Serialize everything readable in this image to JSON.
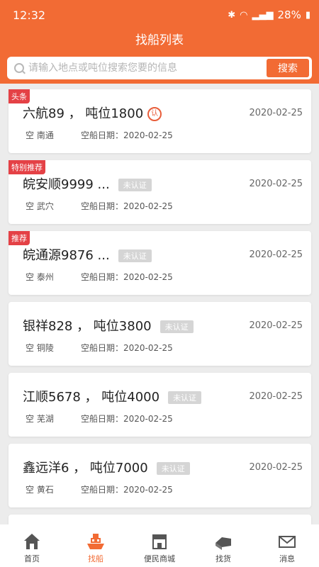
{
  "status_bar": {
    "time": "12:32",
    "battery": "28%"
  },
  "header": {
    "title": "找船列表"
  },
  "search": {
    "placeholder": "请输入地点或吨位搜索您要的信息",
    "button_label": "搜索"
  },
  "list": [
    {
      "tag": "头条",
      "name": "六航89 ， 吨位1800",
      "badge": "",
      "cert": "认",
      "date": "2020-02-25",
      "empty": "空 南通",
      "empty_date": "空船日期：2020-02-25"
    },
    {
      "tag": "特别推荐",
      "name": "皖安顺9999 ...",
      "badge": "未认证",
      "cert": "",
      "date": "2020-02-25",
      "empty": "空 武穴",
      "empty_date": "空船日期：2020-02-25"
    },
    {
      "tag": "推荐",
      "name": "皖通源9876 ...",
      "badge": "未认证",
      "cert": "",
      "date": "2020-02-25",
      "empty": "空 泰州",
      "empty_date": "空船日期：2020-02-25"
    },
    {
      "tag": "",
      "name": "银祥828 ， 吨位3800",
      "badge": "未认证",
      "cert": "",
      "date": "2020-02-25",
      "empty": "空 铜陵",
      "empty_date": "空船日期：2020-02-25"
    },
    {
      "tag": "",
      "name": "江顺5678 ， 吨位4000",
      "badge": "未认证",
      "cert": "",
      "date": "2020-02-25",
      "empty": "空 芜湖",
      "empty_date": "空船日期：2020-02-25"
    },
    {
      "tag": "",
      "name": "鑫远洋6 ， 吨位7000",
      "badge": "未认证",
      "cert": "",
      "date": "2020-02-25",
      "empty": "空 黄石",
      "empty_date": "空船日期：2020-02-25"
    }
  ],
  "tabs": [
    {
      "label": "首页",
      "icon": "home-icon"
    },
    {
      "label": "找船",
      "icon": "ship-icon"
    },
    {
      "label": "便民商城",
      "icon": "shop-icon"
    },
    {
      "label": "找货",
      "icon": "cargo-icon"
    },
    {
      "label": "消息",
      "icon": "mail-icon"
    }
  ],
  "colors": {
    "brand": "#f26b34",
    "tag_red": "#e44146"
  }
}
